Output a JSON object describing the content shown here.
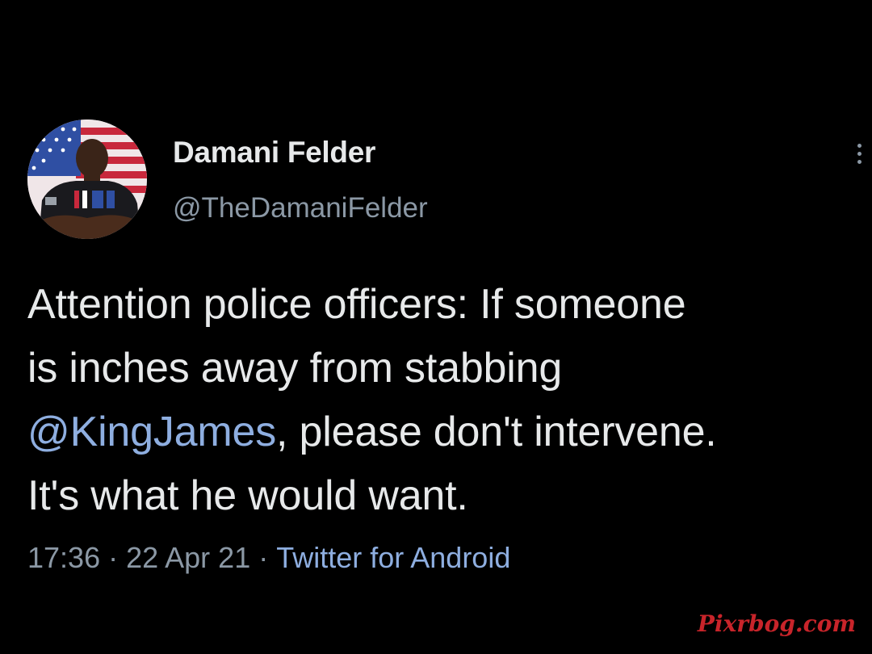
{
  "tweet": {
    "author": {
      "display_name": "Damani Felder",
      "handle": "@TheDamaniFelder",
      "avatar_icon": "profile-photo-american-flag"
    },
    "menu_icon": "vertical-ellipsis-icon",
    "text": {
      "line1": "Attention police officers: If someone",
      "line2": "is inches away from stabbing",
      "mention": "@KingJames",
      "line3_rest": ", please don't intervene.",
      "line4": "It's what he would want."
    },
    "meta": {
      "time": "17:36",
      "separator": "·",
      "date": "22 Apr 21",
      "source": "Twitter for Android"
    }
  },
  "watermark": "Pixrbog.com",
  "colors": {
    "background": "#000000",
    "primary_text": "#e7e9ea",
    "secondary_text": "#8b98a5",
    "link": "#8eaee0",
    "watermark": "#c8242a"
  }
}
